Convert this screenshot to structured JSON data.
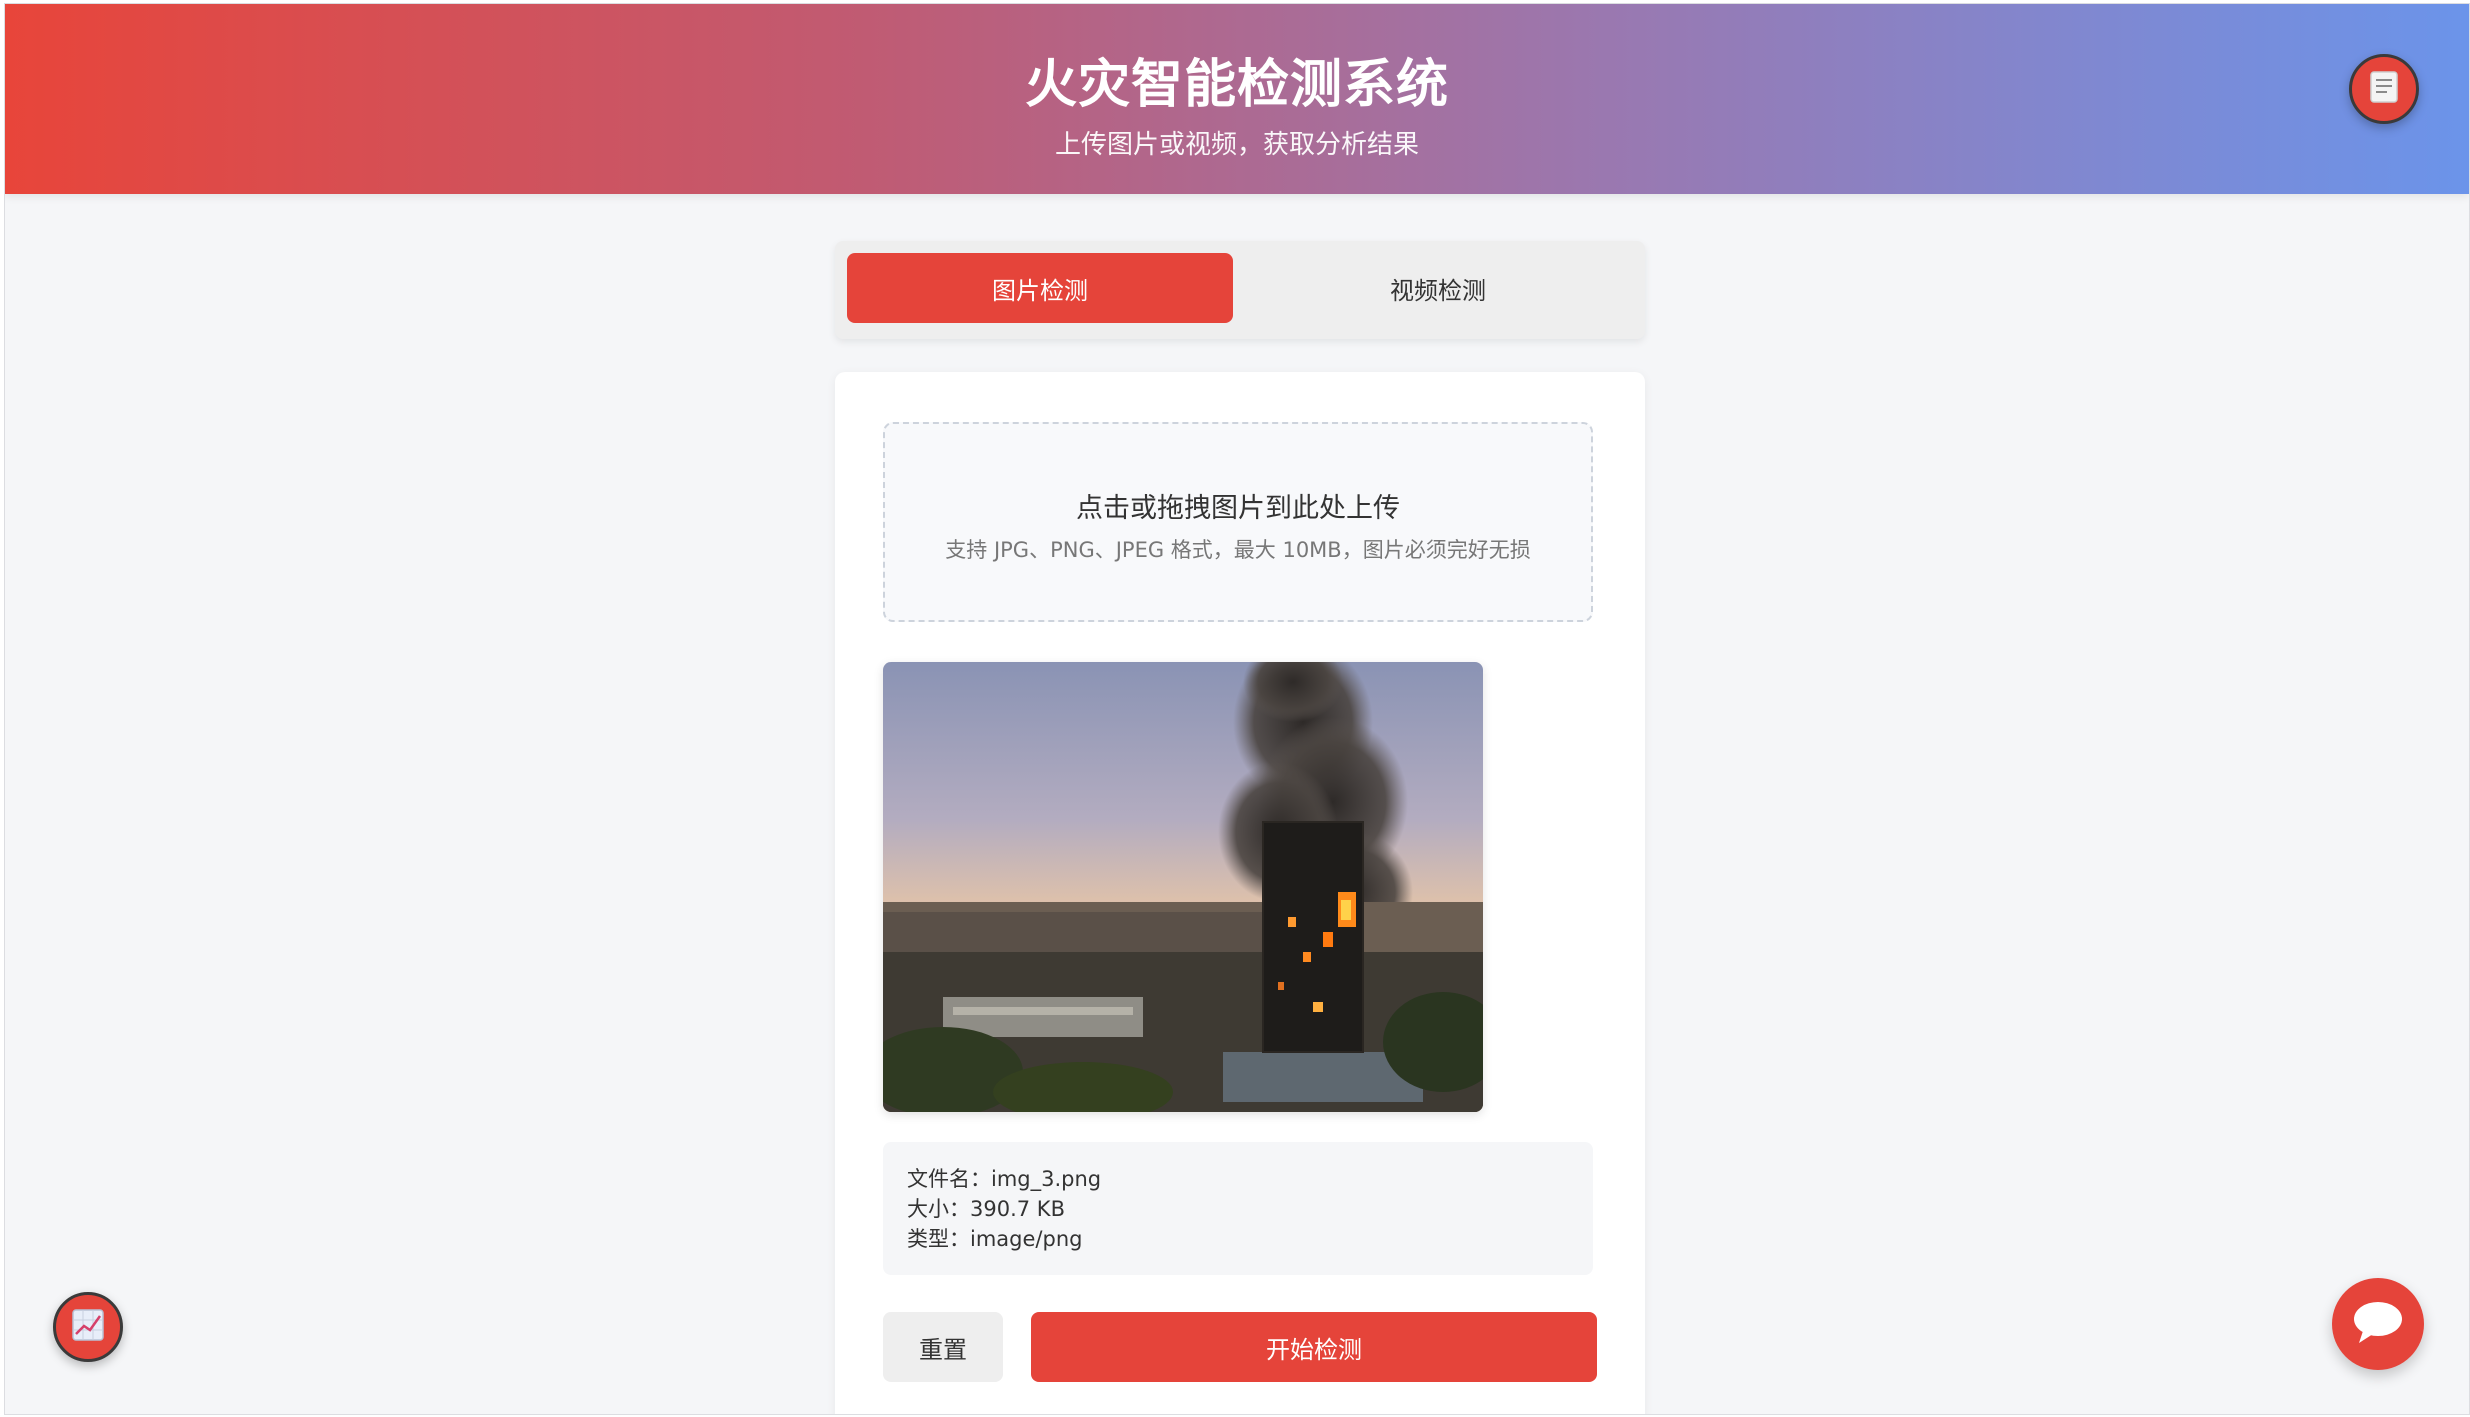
{
  "header": {
    "title": "火灾智能检测系统",
    "subtitle": "上传图片或视频，获取分析结果"
  },
  "tabs": [
    {
      "label": "图片检测",
      "active": true
    },
    {
      "label": "视频检测",
      "active": false
    }
  ],
  "upload": {
    "title": "点击或拖拽图片到此处上传",
    "hint": "支持 JPG、PNG、JPEG 格式，最大 10MB，图片必须完好无损"
  },
  "file_info": {
    "name_label": "文件名：",
    "name_value": "img_3.png",
    "size_label": "大小：",
    "size_value": "390.7 KB",
    "type_label": "类型：",
    "type_value": "image/png"
  },
  "actions": {
    "reset_label": "重置",
    "start_label": "开始检测"
  },
  "floating": {
    "doc_icon": "document-icon",
    "chart_icon": "chart-icon",
    "chat_icon": "chat-bubble-icon"
  },
  "colors": {
    "accent": "#e5443a",
    "header_gradient_start": "#e8453a",
    "header_gradient_end": "#6b94ea"
  }
}
